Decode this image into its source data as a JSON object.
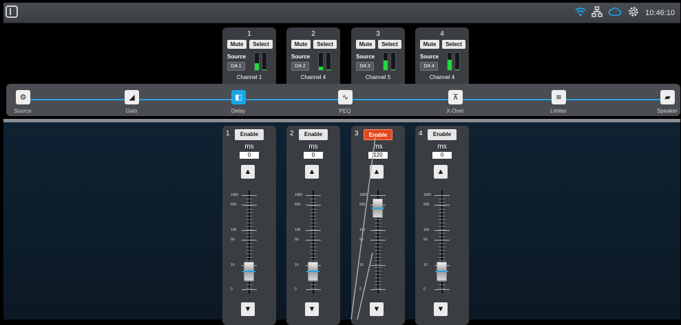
{
  "status": {
    "time": "10:46:10"
  },
  "channels": [
    {
      "num": "1",
      "mute": "Mute",
      "select": "Select",
      "source_label": "Source",
      "source": "DA 1",
      "name": "Channel 1",
      "meter": [
        0.42,
        0.05
      ]
    },
    {
      "num": "2",
      "mute": "Mute",
      "select": "Select",
      "source_label": "Source",
      "source": "DA 2",
      "name": "Channel 4",
      "meter": [
        0.22,
        0.05
      ]
    },
    {
      "num": "3",
      "mute": "Mute",
      "select": "Select",
      "source_label": "Source",
      "source": "DA 3",
      "name": "Channel 5",
      "meter": [
        0.58,
        0.05
      ]
    },
    {
      "num": "4",
      "mute": "Mute",
      "select": "Select",
      "source_label": "Source",
      "source": "DA 4",
      "name": "Channel 4",
      "meter": [
        0.62,
        0.05
      ]
    }
  ],
  "pipeline": [
    {
      "label": "Source",
      "icon": "source-icon",
      "active": false
    },
    {
      "label": "Gain",
      "icon": "gain-icon",
      "active": false
    },
    {
      "label": "Delay",
      "icon": "delay-icon",
      "active": true
    },
    {
      "label": "PEQ",
      "icon": "peq-icon",
      "active": false
    },
    {
      "label": "X-Over",
      "icon": "xover-icon",
      "active": false
    },
    {
      "label": "Limiter",
      "icon": "limiter-icon",
      "active": false
    },
    {
      "label": "Speaker",
      "icon": "speaker-icon",
      "active": false
    }
  ],
  "delays": [
    {
      "num": "1",
      "enable": "Enable",
      "enabled": false,
      "unit": "ms",
      "value": "0"
    },
    {
      "num": "2",
      "enable": "Enable",
      "enabled": false,
      "unit": "ms",
      "value": "0"
    },
    {
      "num": "3",
      "enable": "Enable",
      "enabled": true,
      "unit": "ms",
      "value": "120"
    },
    {
      "num": "4",
      "enable": "Enable",
      "enabled": false,
      "unit": "ms",
      "value": "0"
    }
  ],
  "scale_labels": [
    "1000",
    "500",
    "100",
    "50",
    "10",
    "0"
  ],
  "colors": {
    "accent": "#1aa7e8",
    "meter": "#22d83a",
    "enable_on": "#e0491f"
  }
}
